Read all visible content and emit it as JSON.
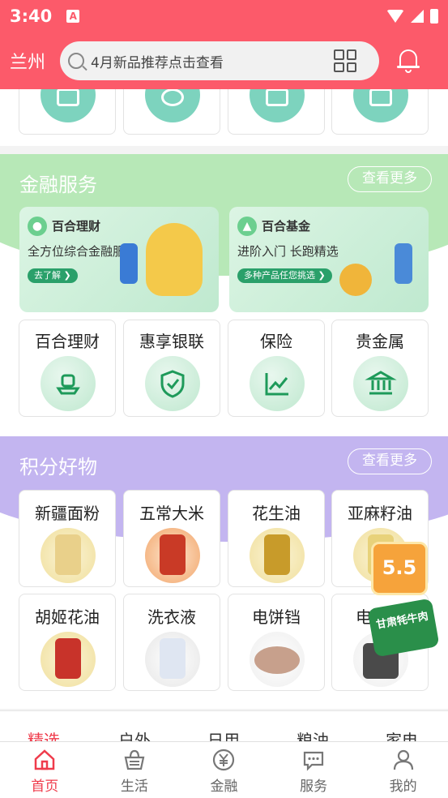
{
  "status": {
    "time": "3:40",
    "notice_glyph": "A"
  },
  "header": {
    "city": "兰州",
    "search_placeholder": "4月新品推荐点击查看"
  },
  "finance": {
    "title": "金融服务",
    "more": "查看更多",
    "banners": [
      {
        "title": "百合理财",
        "subtitle": "全方位综合金融服务",
        "pill": "去了解 ❯"
      },
      {
        "title": "百合基金",
        "subtitle": "进阶入门 长跑精选",
        "pill": "多种产品任您挑选 ❯"
      }
    ],
    "items": [
      {
        "label": "百合理财",
        "icon": "wealth-icon"
      },
      {
        "label": "惠享银联",
        "icon": "shield-check-icon"
      },
      {
        "label": "保险",
        "icon": "trend-chart-icon"
      },
      {
        "label": "贵金属",
        "icon": "bank-icon"
      }
    ]
  },
  "points": {
    "title": "积分好物",
    "more": "查看更多",
    "items": [
      {
        "label": "新疆面粉",
        "color": "#e9d08a"
      },
      {
        "label": "五常大米",
        "color": "#c93a26"
      },
      {
        "label": "花生油",
        "color": "#c89b2a"
      },
      {
        "label": "亚麻籽油",
        "color": "#e8d27a"
      },
      {
        "label": "胡姬花油",
        "color": "#c8332a"
      },
      {
        "label": "洗衣液",
        "color": "#e6ecf5"
      },
      {
        "label": "电饼铛",
        "color": "#c7a08c"
      },
      {
        "label": "电饭煲",
        "color": "#4a4a4a"
      }
    ]
  },
  "promo": {
    "badge": "5.5",
    "tag": "甘肃牦牛肉"
  },
  "tabs": [
    "精选",
    "户外",
    "日用",
    "粮油",
    "家电"
  ],
  "nav": [
    {
      "label": "首页",
      "icon": "home-icon",
      "active": true
    },
    {
      "label": "生活",
      "icon": "basket-icon"
    },
    {
      "label": "金融",
      "icon": "yuan-icon"
    },
    {
      "label": "服务",
      "icon": "chat-icon"
    },
    {
      "label": "我的",
      "icon": "user-icon"
    }
  ]
}
